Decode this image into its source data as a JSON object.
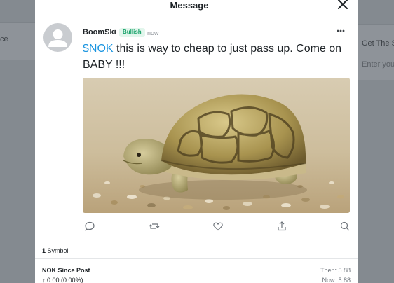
{
  "background": {
    "left_text": "ce",
    "right_title": "Get The S",
    "right_input": "Enter you"
  },
  "modal": {
    "title": "Message"
  },
  "post": {
    "username": "BoomSki",
    "sentiment": "Bullish",
    "timestamp": "now",
    "cashtag": "$NOK",
    "body": " this is way to cheap to just pass up. Come on BABY !!!"
  },
  "symbols": {
    "count": "1",
    "label": "Symbol",
    "since_title": "NOK Since Post",
    "change": "↑ 0.00 (0.00%)",
    "then": "Then: 5.88",
    "now": "Now: 5.88"
  },
  "colors": {
    "accent": "#1b95e0",
    "bullish": "#1aa36b",
    "overlay": "#8a8f95"
  }
}
